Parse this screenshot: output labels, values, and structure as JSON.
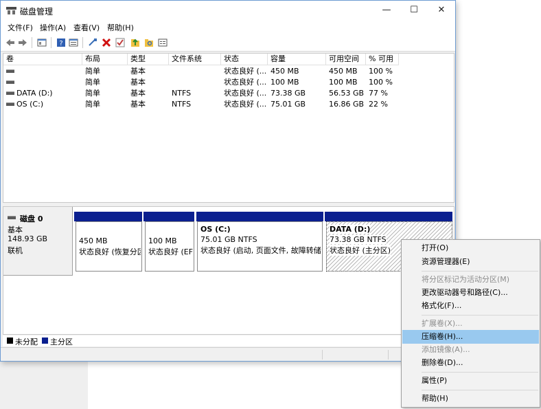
{
  "window": {
    "title": "磁盘管理",
    "controls": {
      "minimize": "—",
      "maximize": "☐",
      "close": "✕"
    }
  },
  "menubar": [
    "文件(F)",
    "操作(A)",
    "查看(V)",
    "帮助(H)"
  ],
  "toolbar_icons": [
    "back-arrow-icon",
    "forward-arrow-icon",
    "console-tree-icon",
    "help-icon",
    "list-view-icon",
    "connect-icon",
    "delete-icon",
    "check-icon",
    "folder-up-icon",
    "folder-search-icon",
    "properties-icon"
  ],
  "volume_table": {
    "columns": [
      "卷",
      "布局",
      "类型",
      "文件系统",
      "状态",
      "容量",
      "可用空间",
      "% 可用"
    ],
    "rows": [
      {
        "volume": "",
        "layout": "简单",
        "type": "基本",
        "fs": "",
        "status": "状态良好 (...",
        "capacity": "450 MB",
        "free": "450 MB",
        "pct": "100 %"
      },
      {
        "volume": "",
        "layout": "简单",
        "type": "基本",
        "fs": "",
        "status": "状态良好 (...",
        "capacity": "100 MB",
        "free": "100 MB",
        "pct": "100 %"
      },
      {
        "volume": "DATA (D:)",
        "layout": "简单",
        "type": "基本",
        "fs": "NTFS",
        "status": "状态良好 (...",
        "capacity": "73.38 GB",
        "free": "56.53 GB",
        "pct": "77 %"
      },
      {
        "volume": "OS (C:)",
        "layout": "简单",
        "type": "基本",
        "fs": "NTFS",
        "status": "状态良好 (...",
        "capacity": "75.01 GB",
        "free": "16.86 GB",
        "pct": "22 %"
      }
    ]
  },
  "disk": {
    "name": "磁盘 0",
    "type": "基本",
    "size": "148.93 GB",
    "status": "联机",
    "partitions": [
      {
        "name": "",
        "size": "450 MB",
        "status": "状态良好 (恢复分区"
      },
      {
        "name": "",
        "size": "100 MB",
        "status": "状态良好 (EFI"
      },
      {
        "name": "OS  (C:)",
        "size": "75.01 GB NTFS",
        "status": "状态良好 (启动, 页面文件, 故障转储,"
      },
      {
        "name": "DATA  (D:)",
        "size": "73.38 GB NTFS",
        "status": "状态良好 (主分区)"
      }
    ]
  },
  "legend": [
    {
      "label": "未分配",
      "color": "#000000"
    },
    {
      "label": "主分区",
      "color": "#0a1f8f"
    }
  ],
  "context_menu": {
    "items": [
      {
        "label": "打开(O)",
        "disabled": false
      },
      {
        "label": "资源管理器(E)",
        "disabled": false
      },
      {
        "label": "将分区标记为活动分区(M)",
        "disabled": true
      },
      {
        "label": "更改驱动器号和路径(C)...",
        "disabled": false
      },
      {
        "label": "格式化(F)...",
        "disabled": false
      },
      {
        "label": "扩展卷(X)...",
        "disabled": true
      },
      {
        "label": "压缩卷(H)...",
        "disabled": false,
        "highlighted": true
      },
      {
        "label": "添加镜像(A)...",
        "disabled": true
      },
      {
        "label": "删除卷(D)...",
        "disabled": false
      },
      {
        "label": "属性(P)",
        "disabled": false
      },
      {
        "label": "帮助(H)",
        "disabled": false
      }
    ]
  },
  "colors": {
    "primary_partition": "#0a1f8f",
    "menu_highlight": "#99c9ef"
  }
}
